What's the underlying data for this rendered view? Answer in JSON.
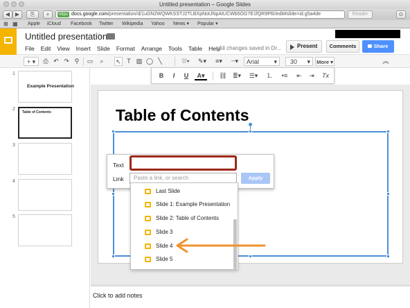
{
  "window": {
    "title": "Untitled presentation – Google Slides"
  },
  "browser": {
    "url_scheme": "https",
    "url_host": "docs.google.com",
    "url_path": "/presentation/d/1uGN2WQWKSSTJ2TLBXpNotJNpAtUCWb5OG7E1fQR9P6I/edit#slide=id.g5a4de",
    "reader_label": "Reader",
    "bookmarks": [
      "Apple",
      "iCloud",
      "Facebook",
      "Twitter",
      "Wikipedia",
      "Yahoo",
      "News ▾",
      "Popular ▾"
    ]
  },
  "app": {
    "doc_title": "Untitled presentation",
    "menus": [
      "File",
      "Edit",
      "View",
      "Insert",
      "Slide",
      "Format",
      "Arrange",
      "Tools",
      "Table",
      "Help"
    ],
    "save_status": "All changes saved in Dr...",
    "present_label": "Present",
    "comments_label": "Comments",
    "share_label": "Share",
    "accent_color": "#f4b400",
    "share_color": "#4d90fe"
  },
  "toolbar": {
    "font": "Arial",
    "font_size": "30",
    "more_label": "More"
  },
  "format_bar": {
    "bold": "B",
    "italic": "I",
    "underline": "U",
    "text_color": "A",
    "clear_format": "Tx"
  },
  "filmstrip": {
    "slides": [
      {
        "number": "1",
        "text": "Example Presentation"
      },
      {
        "number": "2",
        "text": "Table of Contents"
      },
      {
        "number": "3",
        "text": ""
      },
      {
        "number": "4",
        "text": ""
      },
      {
        "number": "5",
        "text": ""
      }
    ],
    "selected_index": 1
  },
  "slide": {
    "title": "Table of Contents"
  },
  "link_dialog": {
    "text_label": "Text",
    "link_label": "Link",
    "text_value": "",
    "link_placeholder": "Paste a link, or search",
    "apply_label": "Apply",
    "highlight_color": "#9c2716"
  },
  "link_dropdown": {
    "items": [
      "Last Slide",
      "Slide 1: Example Presentation",
      "Slide 2: Table of Contents",
      "Slide 3",
      "Slide 4",
      "Slide 5"
    ],
    "arrow_target": "Slide 4",
    "arrow_color": "#f0922e"
  },
  "notes": {
    "placeholder": "Click to add notes"
  }
}
